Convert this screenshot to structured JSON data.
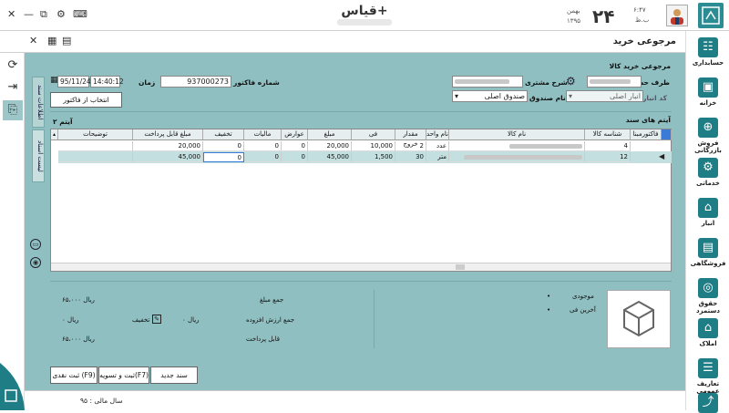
{
  "window": {
    "app_title": "قیاس+",
    "min_icon": "—",
    "restore_icon": "⧉",
    "close_icon": "✕",
    "gear_icon": "⚙",
    "keyboard_icon": "⌨"
  },
  "clock": {
    "time": "۶:۴۷",
    "period": "ب.ظ",
    "day": "۲۴",
    "month": "بهمن",
    "year": "۱۳۹۵"
  },
  "page": {
    "title": "مرجوعی خرید",
    "form_title": "مرجوعی خرید کالا"
  },
  "toolbar": {
    "close": "✕",
    "calc": "▦",
    "cal": "▤"
  },
  "side_tabs": [
    "اطلاعات سند",
    "لیست اسناد"
  ],
  "fields": {
    "party_label": "طرف حساب",
    "customer_desc_label": "شرح مشتری",
    "invoice_no_label": "شماره فاکتور",
    "invoice_no": "937000273",
    "time_label": "زمان",
    "time_value": "14:40:12",
    "date_value": "95/11/24",
    "warehouse_code_label": "کد انبار",
    "warehouse_value": "انبار اصلی",
    "cashbox_label": "نام صندوق",
    "cashbox_value": "صندوق اصلی",
    "select_invoice_btn": "انتخاب از فاکتور"
  },
  "grid": {
    "section_label": "آیتم های سند",
    "item_count": "۲ آیتم",
    "headers": [
      "فاکتورمبنا",
      "شناسه کالا",
      "نام کالا",
      "نام واحد",
      "مقدار خروج",
      "فی",
      "مبلغ",
      "عوارض",
      "مالیات",
      "تخفیف",
      "مبلغ قابل پرداخت",
      "توضیحات"
    ],
    "rows": [
      {
        "id": "4",
        "unit": "عدد",
        "qty": "2",
        "price": "10,000",
        "amount": "20,000",
        "duty": "0",
        "tax": "0",
        "disc": "0",
        "payable": "20,000",
        "desc": ""
      },
      {
        "id": "12",
        "unit": "متر",
        "qty": "30",
        "price": "1,500",
        "amount": "45,000",
        "duty": "0",
        "tax": "0",
        "disc": "0",
        "payable": "45,000",
        "desc": ""
      }
    ]
  },
  "summary": {
    "total_label": "جمع مبلغ",
    "total_value": "۶۵،۰۰۰ ریال",
    "vat_label": "جمع ارزش افزوده",
    "vat_value": "۰ ریال",
    "discount_label": "تخفیف",
    "discount_value": "۰ ریال",
    "payable_label": "قابل پرداخت",
    "payable_value": "۶۵،۰۰۰ ریال",
    "stock_label": "موجودی",
    "last_price_label": "آخرین فی"
  },
  "actions": {
    "new_doc": "سند جدید",
    "save_settle": "ثبت و تسویه(F7)",
    "save_cash": "ثبت نقدی (F9)"
  },
  "status": {
    "fiscal_year": "سال مالی : ۹۵"
  },
  "nav": [
    {
      "label": "حسابداری",
      "icon": "☷"
    },
    {
      "label": "خزانه",
      "icon": "▣"
    },
    {
      "label": "فروش بازرگانی",
      "icon": "⊕"
    },
    {
      "label": "خدماتی",
      "icon": "⚙"
    },
    {
      "label": "انبار",
      "icon": "⌂"
    },
    {
      "label": "فروشگاهی",
      "icon": "▤"
    },
    {
      "label": "حقوق دستمزد",
      "icon": "◎"
    },
    {
      "label": "املاک",
      "icon": "⌂"
    },
    {
      "label": "تعاریف عمومی",
      "icon": "☰"
    },
    {
      "label": "",
      "icon": "⤴"
    }
  ]
}
